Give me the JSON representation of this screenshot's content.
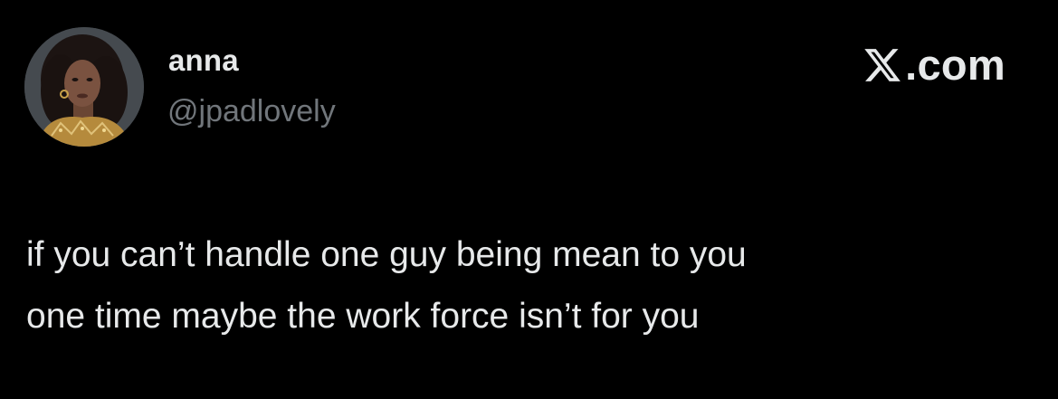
{
  "author": {
    "display_name": "anna",
    "handle": "@jpadlovely"
  },
  "brand": {
    "icon": "x-logo-icon",
    "text": ".com"
  },
  "tweet": {
    "lines": [
      "if you can’t handle one guy being mean to you",
      "one time maybe the work force isn’t for you"
    ]
  },
  "colors": {
    "background": "#000000",
    "primary_text": "#e7e9ea",
    "secondary_text": "#71767b"
  }
}
